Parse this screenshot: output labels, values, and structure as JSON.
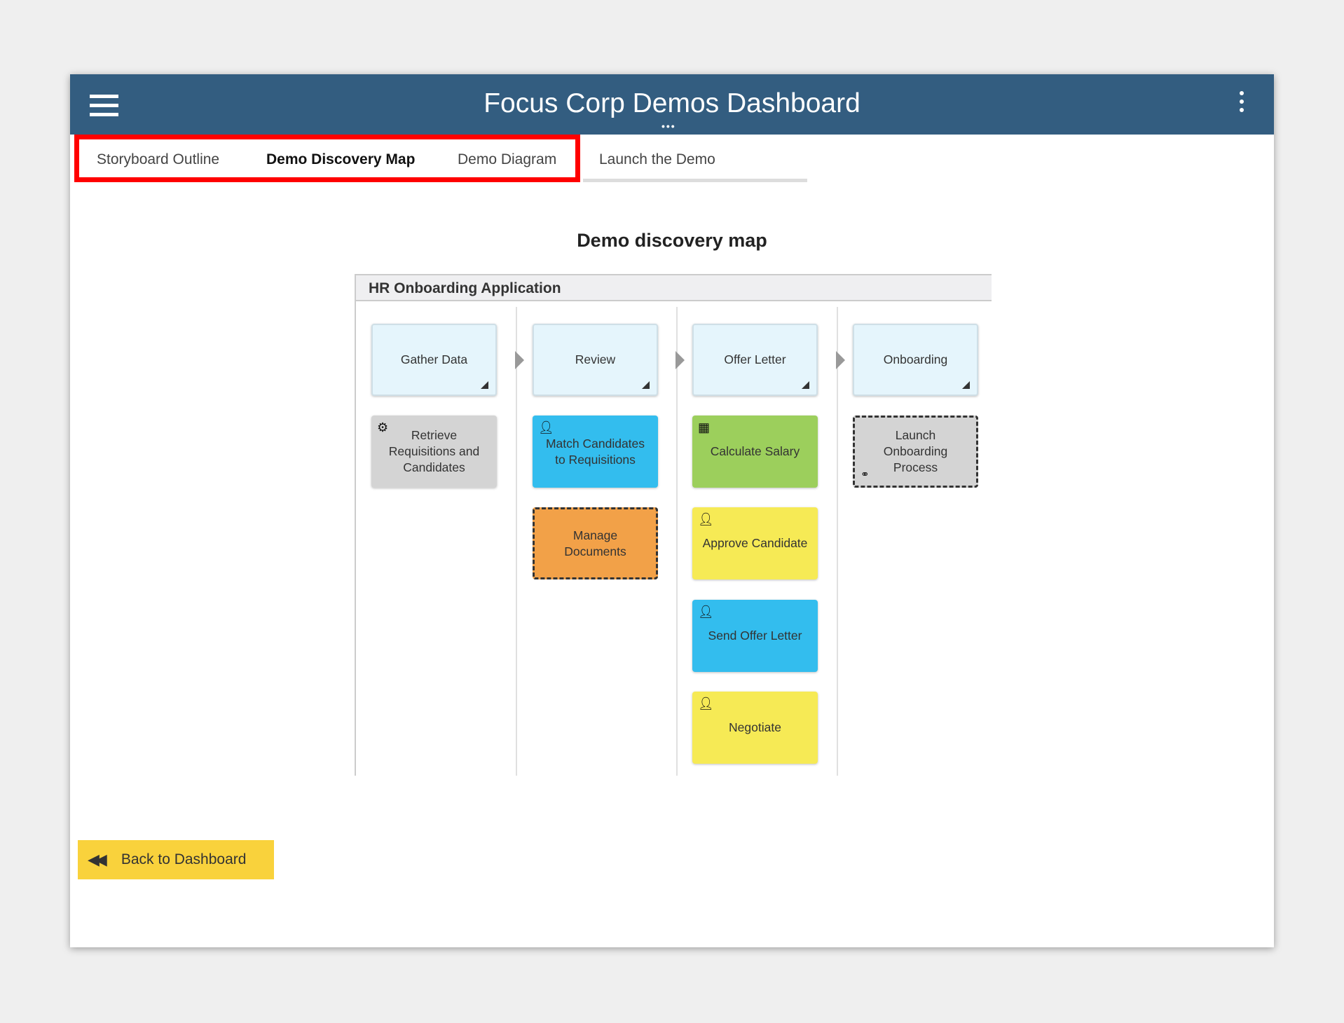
{
  "header": {
    "title": "Focus Corp Demos Dashboard",
    "menu_icon": "hamburger-icon",
    "more_icon": "kebab-vertical-icon"
  },
  "tabs": [
    {
      "label": "Storyboard Outline"
    },
    {
      "label": "Demo Discovery Map",
      "active": true
    },
    {
      "label": "Demo Diagram"
    },
    {
      "label": "Launch the Demo"
    }
  ],
  "main": {
    "heading": "Demo discovery map"
  },
  "diagram": {
    "title": "HR Onboarding Application",
    "stages": [
      "Gather Data",
      "Review",
      "Offer Letter",
      "Onboarding"
    ],
    "activities": [
      {
        "label": "Retrieve Requisitions and Candidates",
        "icon": "gear-icon",
        "color": "#d4d4d4"
      },
      {
        "label": "Match Candidates to Requisitions",
        "icon": "user-icon",
        "color": "#33bdee"
      },
      {
        "label": "Manage Documents",
        "icon": "",
        "color": "#f2a148"
      },
      {
        "label": "Calculate Salary",
        "icon": "table-icon",
        "color": "#9ccf5c"
      },
      {
        "label": "Approve Candidate",
        "icon": "user-icon",
        "color": "#f6ea55"
      },
      {
        "label": "Send Offer Letter",
        "icon": "user-icon",
        "color": "#33bdee"
      },
      {
        "label": "Negotiate",
        "icon": "user-icon",
        "color": "#f6ea55"
      },
      {
        "label": "Launch Onboarding Process",
        "icon": "link-icon",
        "color": "#d4d4d4"
      }
    ]
  },
  "footer": {
    "back_label": "Back to Dashboard"
  },
  "colors": {
    "header": "#335d80",
    "highlight": "#ff0000",
    "back_button": "#f9d23c"
  }
}
